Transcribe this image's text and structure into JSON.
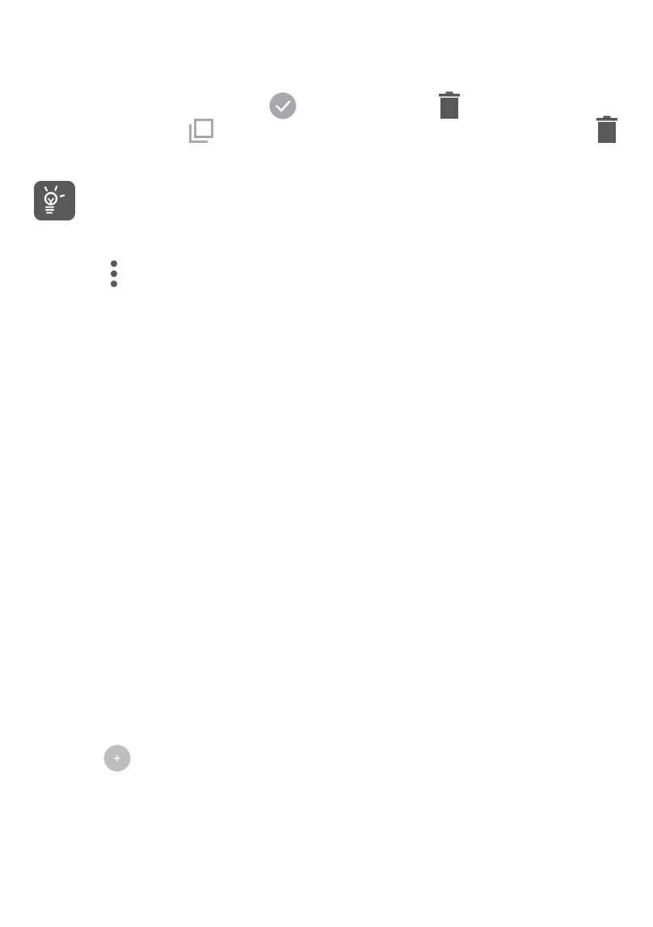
{
  "colors": {
    "icon_dark": "#58595b",
    "icon_light": "#a7a9ac",
    "tip_badge_bg": "#58595b",
    "fab_bg": "#bcbec0",
    "fab_plus": "#ffffff"
  },
  "icons": {
    "row1": [
      "check-circle-icon",
      "trash-icon"
    ],
    "row2": [
      "copy-icon",
      "trash-icon"
    ],
    "tip": "lightbulb-tip-icon",
    "menu": "more-vertical-icon",
    "fab": "plus-icon"
  }
}
